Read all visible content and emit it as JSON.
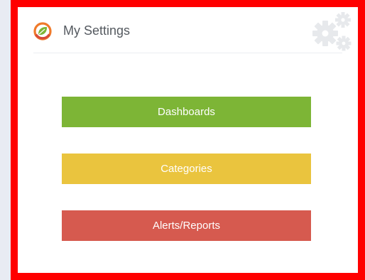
{
  "widget": {
    "title": "My Settings",
    "logo_icon": "leaf-ring-logo-icon",
    "settings_icon": "gears-icon"
  },
  "buttons": {
    "dashboards": {
      "label": "Dashboards",
      "color": "#7db536"
    },
    "categories": {
      "label": "Categories",
      "color": "#eac43e"
    },
    "alerts_reports": {
      "label": "Alerts/Reports",
      "color": "#d65a4f"
    }
  },
  "colors": {
    "frame_border": "#ff0000",
    "page_background": "#e8ebf3",
    "panel_background": "#ffffff",
    "title_text": "#555a60"
  }
}
